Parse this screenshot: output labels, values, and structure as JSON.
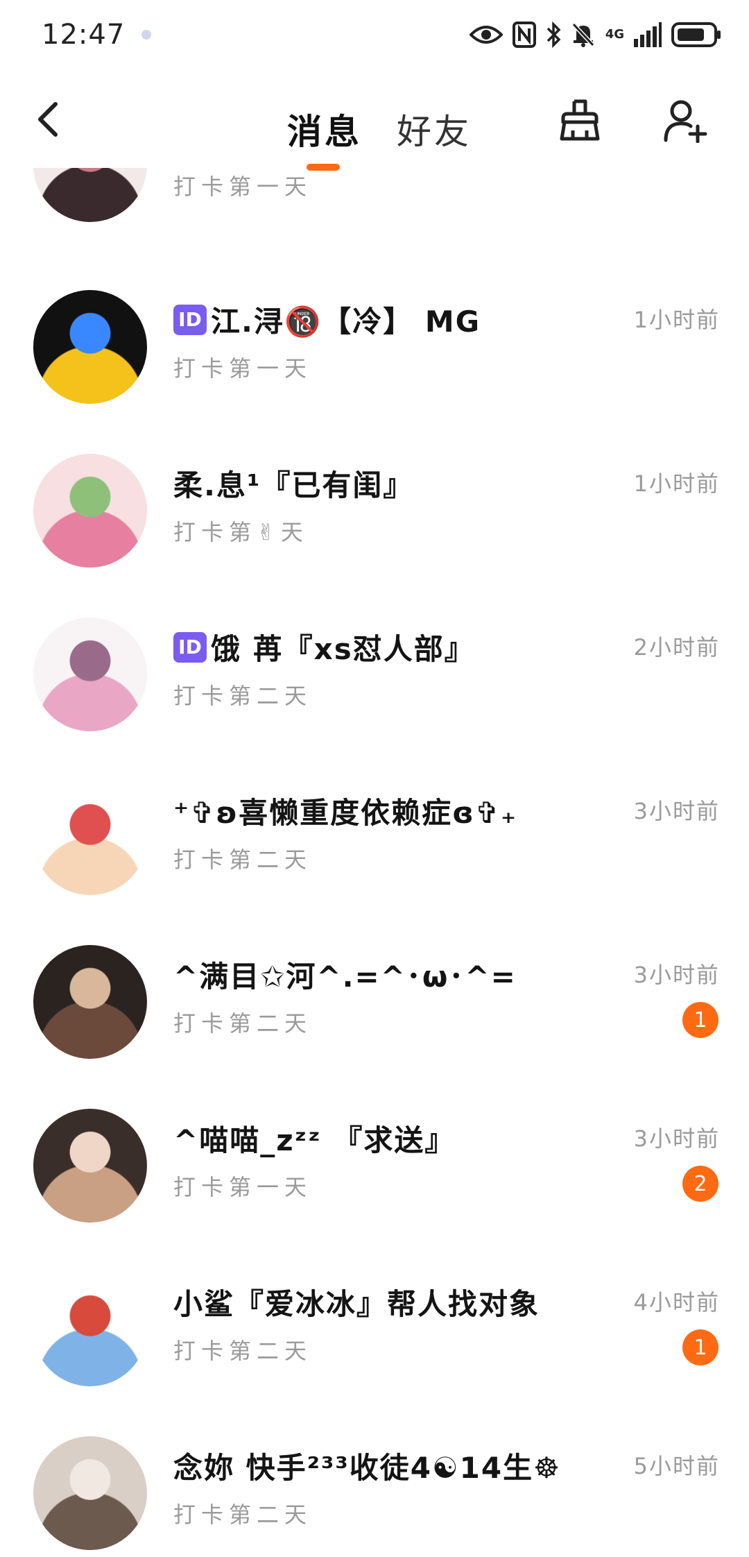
{
  "status_bar": {
    "time": "12:47",
    "network": "4G"
  },
  "nav": {
    "tabs": [
      {
        "label": "消息"
      },
      {
        "label": "好友"
      }
    ]
  },
  "messages": [
    {
      "name": "",
      "has_id_badge": false,
      "subtitle": "打卡第一天",
      "time": "",
      "unread": "",
      "avatar_colors": [
        "#f2e9e8",
        "#3a2a2e",
        "#c87b86"
      ]
    },
    {
      "name": "江.浔🔞【冷】 MG",
      "has_id_badge": true,
      "subtitle": "打卡第一天",
      "time": "1小时前",
      "unread": "",
      "avatar_colors": [
        "#111111",
        "#f5c21b",
        "#3a88ff"
      ]
    },
    {
      "name": "柔.息¹『已有闺』",
      "has_id_badge": false,
      "subtitle": "打卡第✌天",
      "time": "1小时前",
      "unread": "",
      "avatar_colors": [
        "#f7dfe2",
        "#e77fa0",
        "#8fc07a"
      ]
    },
    {
      "name": "饿 苒『xs怼人部』",
      "has_id_badge": true,
      "subtitle": "打卡第二天",
      "time": "2小时前",
      "unread": "",
      "avatar_colors": [
        "#f8f4f6",
        "#e9a7c5",
        "#9a6a8a"
      ]
    },
    {
      "name": "⁺✞ʚ喜懒重度依赖症ɞ✞₊",
      "has_id_badge": false,
      "subtitle": "打卡第二天",
      "time": "3小时前",
      "unread": "",
      "avatar_colors": [
        "#ffffff",
        "#f7d6b8",
        "#e05050"
      ]
    },
    {
      "name": "^满目✩河^.=^･ω･^=",
      "has_id_badge": false,
      "subtitle": "打卡第二天",
      "time": "3小时前",
      "unread": "1",
      "avatar_colors": [
        "#2a2320",
        "#6b4a3c",
        "#d9b79a"
      ]
    },
    {
      "name": "^喵喵_zᶻᶻ 『求送』",
      "has_id_badge": false,
      "subtitle": "打卡第一天",
      "time": "3小时前",
      "unread": "2",
      "avatar_colors": [
        "#3a2e2a",
        "#c9a083",
        "#f0d6c6"
      ]
    },
    {
      "name": "小鲨『爱冰冰』帮人找对象",
      "has_id_badge": false,
      "subtitle": "打卡第二天",
      "time": "4小时前",
      "unread": "1",
      "avatar_colors": [
        "#ffffff",
        "#7fb3e8",
        "#d84b3c"
      ]
    },
    {
      "name": "念妳 快手²³³收徒4☯14生☸",
      "has_id_badge": false,
      "subtitle": "打卡第二天",
      "time": "5小时前",
      "unread": "",
      "avatar_colors": [
        "#d9cfc7",
        "#6c5a4e",
        "#f1e8e2"
      ]
    }
  ]
}
